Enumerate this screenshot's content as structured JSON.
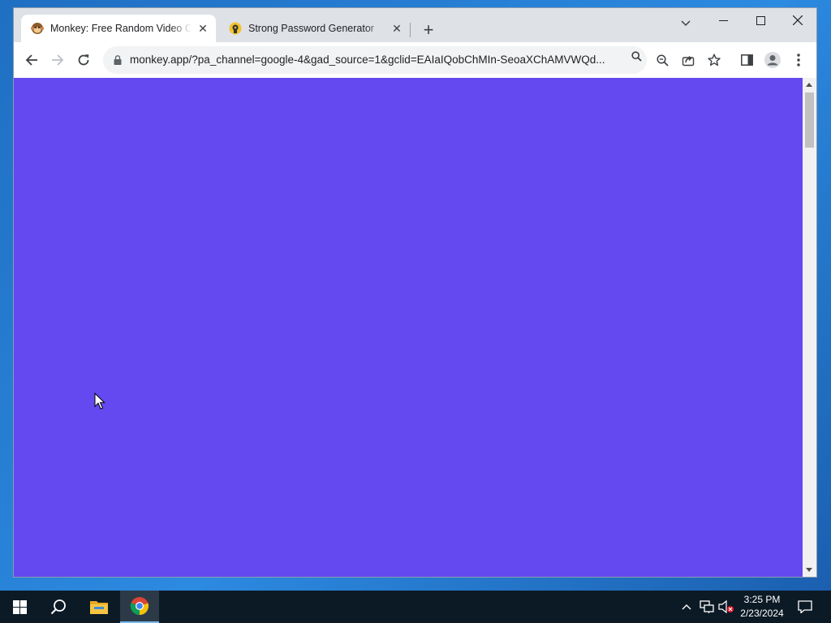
{
  "browser": {
    "tabs": [
      {
        "title": "Monkey: Free Random Video Chat",
        "active": true,
        "favicon": "monkey-emoji-icon"
      },
      {
        "title": "Strong Password Generator",
        "active": false,
        "favicon": "password-site-icon"
      }
    ],
    "close_glyph": "✕",
    "new_tab_glyph": "+",
    "url": "monkey.app/?pa_channel=google-4&gad_source=1&gclid=EAIaIQobChMIn-SeoaXChAMVWQd...",
    "icons": [
      "back-icon",
      "forward-icon",
      "reload-icon",
      "lock-icon",
      "search-icon",
      "zoom-icon",
      "share-icon",
      "bookmark-star-icon",
      "side-panel-icon",
      "profile-icon",
      "menu-icon"
    ]
  },
  "page": {
    "background_color": "#6349ef"
  },
  "taskbar": {
    "time": "3:25 PM",
    "date": "2/23/2024",
    "apps": [
      "windows-start-icon",
      "search-icon",
      "file-explorer-icon",
      "chrome-icon"
    ],
    "tray_icons": [
      "chevron-up-icon",
      "network-icon",
      "volume-muted-icon",
      "notification-icon"
    ]
  }
}
